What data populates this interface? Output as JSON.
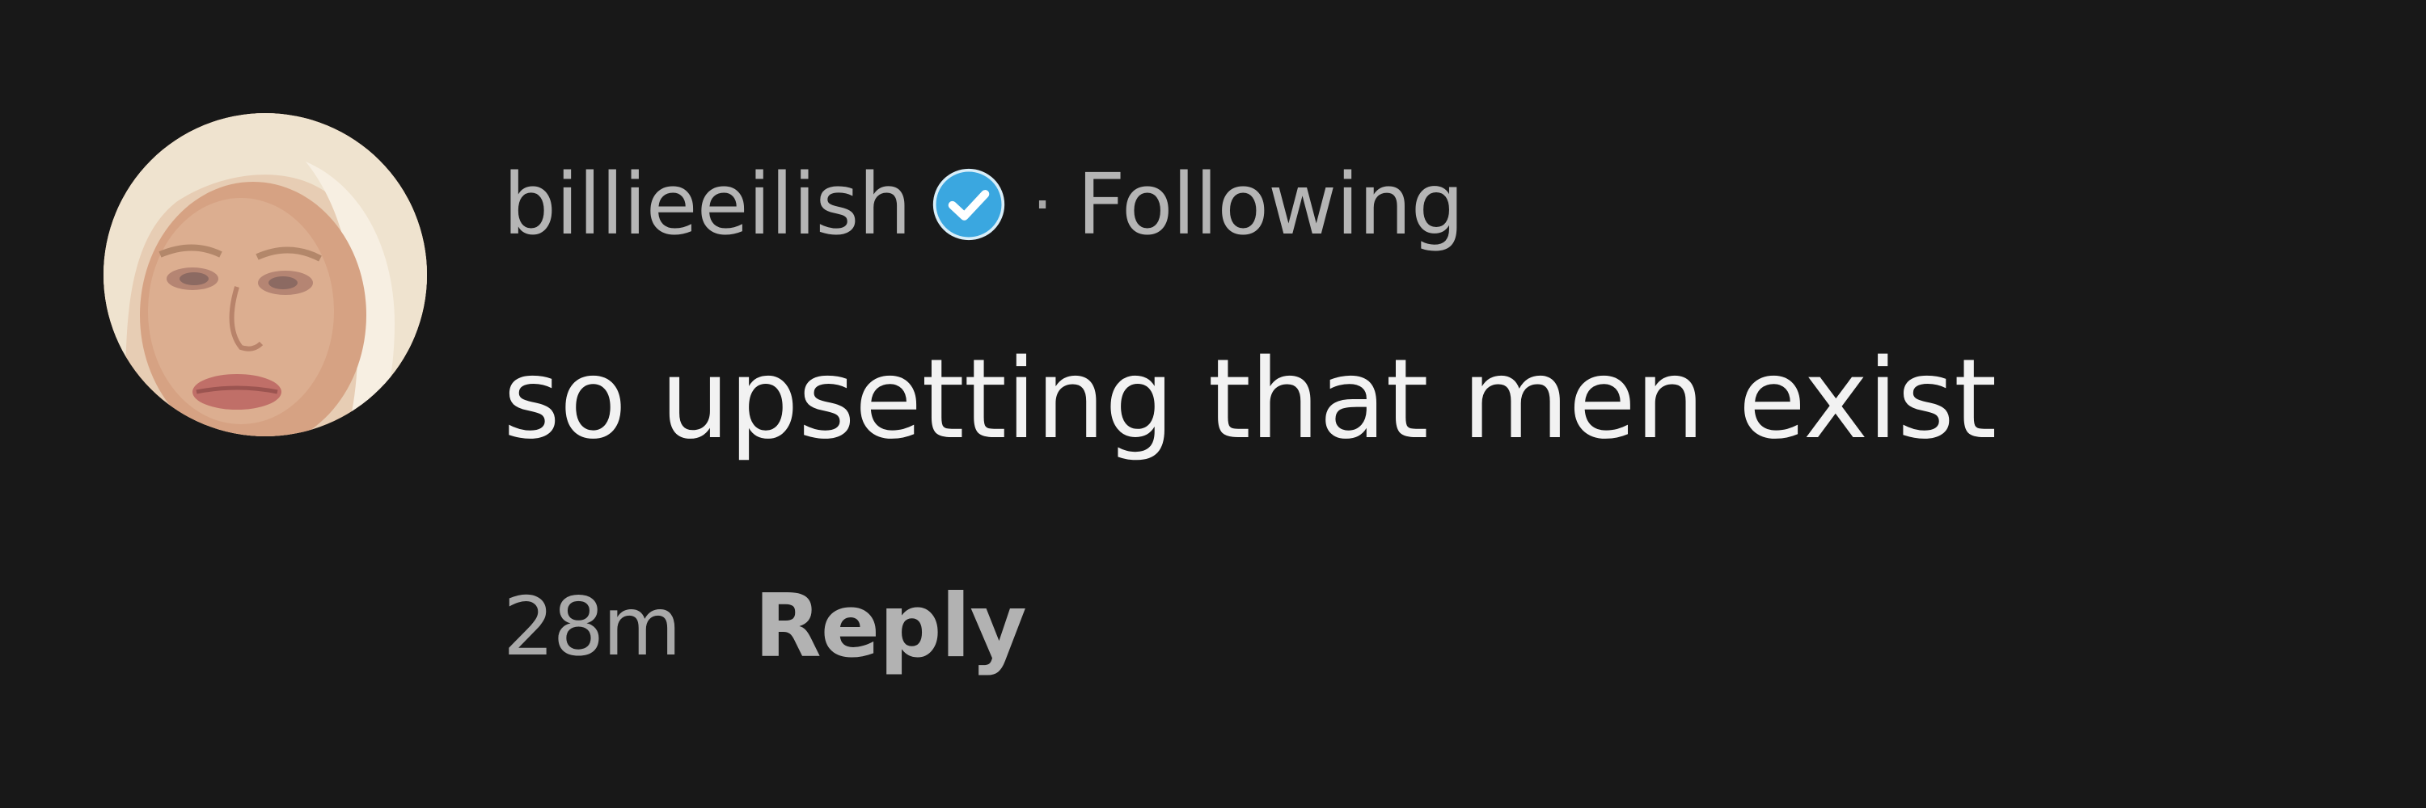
{
  "comment": {
    "username": "billieeilish",
    "verified_icon": "verified-badge-icon",
    "separator": "·",
    "follow_status": "Following",
    "text": "so upsetting that men exist",
    "time_ago": "28m",
    "reply_label": "Reply"
  },
  "colors": {
    "background": "#181818",
    "username": "#b5b5b5",
    "body_text": "#f2f2f2",
    "meta_text": "#a9a9a9",
    "verified_badge": "#3aa7e0"
  }
}
